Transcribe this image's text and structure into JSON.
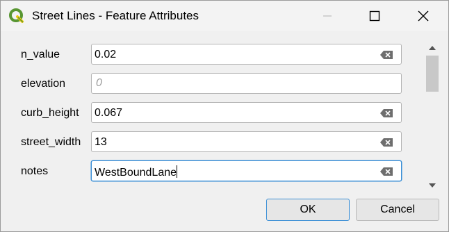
{
  "window": {
    "title": "Street Lines - Feature Attributes",
    "app_icon": "qgis-logo-icon",
    "controls": [
      "minimize-icon",
      "maximize-icon",
      "close-icon"
    ]
  },
  "form": {
    "fields": [
      {
        "label": "n_value",
        "value": "0.02",
        "placeholder": "",
        "clearable": true
      },
      {
        "label": "elevation",
        "value": "",
        "placeholder": "0",
        "clearable": false
      },
      {
        "label": "curb_height",
        "value": "0.067",
        "placeholder": "",
        "clearable": true
      },
      {
        "label": "street_width",
        "value": "13",
        "placeholder": "",
        "clearable": true
      },
      {
        "label": "notes",
        "value": "WestBoundLane",
        "placeholder": "",
        "clearable": true,
        "focused": true
      }
    ]
  },
  "buttons": {
    "ok": "OK",
    "cancel": "Cancel"
  },
  "colors": {
    "focus": "#3b8fd6",
    "qgis_green": "#589632",
    "qgis_yellow": "#eec90d"
  }
}
